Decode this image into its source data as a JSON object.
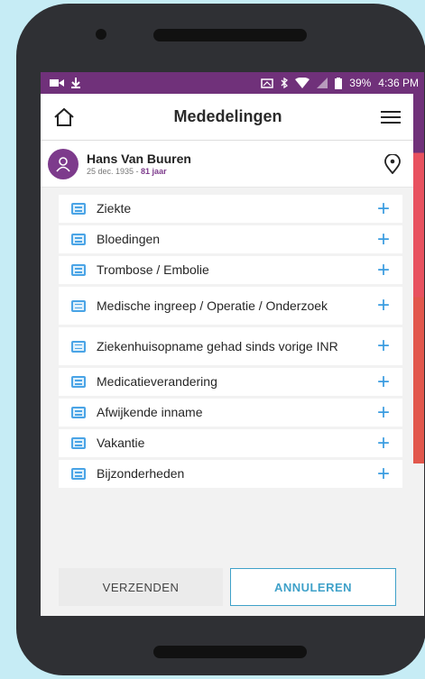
{
  "status_bar": {
    "battery": "39%",
    "time": "4:36 PM",
    "icons": [
      "video-icon",
      "download-icon",
      "screen-icon",
      "bluetooth-icon",
      "wifi-icon",
      "signal-icon",
      "battery-icon"
    ]
  },
  "header": {
    "title": "Mededelingen",
    "home_icon": "home-icon",
    "menu_icon": "menu-icon"
  },
  "patient": {
    "name": "Hans Van Buuren",
    "dob": "25 dec. 1935 - ",
    "age": "81 jaar",
    "avatar_icon": "user-icon",
    "location_icon": "location-pin-icon"
  },
  "items": [
    {
      "label": "Ziekte"
    },
    {
      "label": "Bloedingen"
    },
    {
      "label": "Trombose / Embolie"
    },
    {
      "label": "Medische ingreep / Operatie / Onderzoek"
    },
    {
      "label": "Ziekenhuisopname gehad sinds vorige INR"
    },
    {
      "label": "Medicatieverandering"
    },
    {
      "label": "Afwijkende inname"
    },
    {
      "label": "Vakantie"
    },
    {
      "label": "Bijzonderheden"
    }
  ],
  "footer": {
    "send_label": "VERZENDEN",
    "cancel_label": "ANNULEREN"
  },
  "colors": {
    "status_bar": "#70317a",
    "accent_blue": "#3a9ce0",
    "avatar": "#7d3b8c",
    "cancel_border": "#3fa1c9",
    "background": "#c6ecf5"
  }
}
